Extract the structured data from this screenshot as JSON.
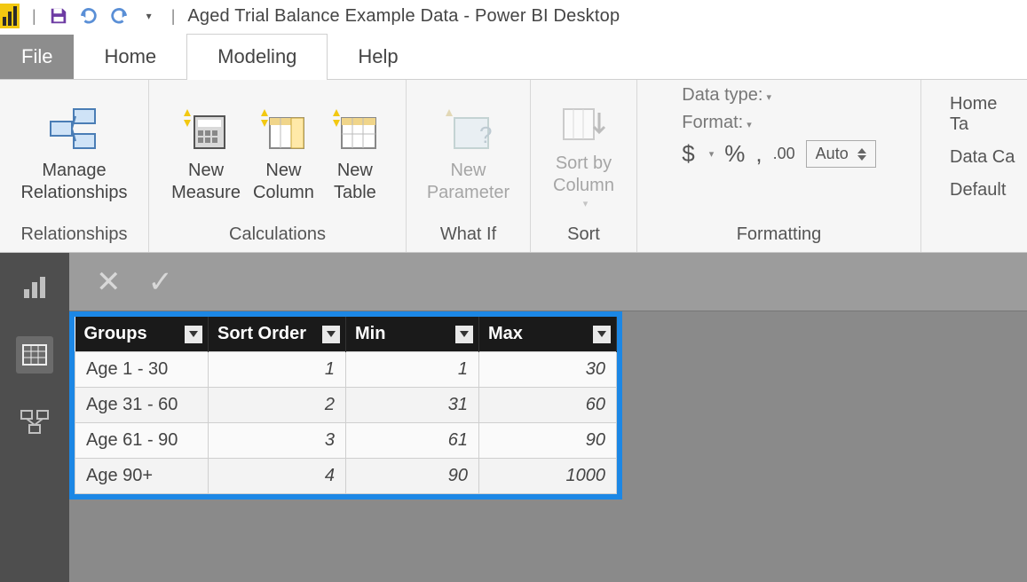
{
  "title": "Aged Trial Balance Example Data - Power BI Desktop",
  "menu": {
    "file": "File",
    "home": "Home",
    "modeling": "Modeling",
    "help": "Help"
  },
  "ribbon": {
    "relationships": {
      "manage": "Manage\nRelationships",
      "group": "Relationships"
    },
    "calculations": {
      "measure": "New\nMeasure",
      "column": "New\nColumn",
      "table": "New\nTable",
      "group": "Calculations"
    },
    "whatif": {
      "parameter": "New\nParameter",
      "group": "What If"
    },
    "sort": {
      "sortby": "Sort by\nColumn",
      "group": "Sort"
    },
    "formatting": {
      "datatype": "Data type:",
      "format": "Format:",
      "auto": "Auto",
      "group": "Formatting"
    },
    "properties": {
      "hometable": "Home Ta",
      "datacat": "Data Ca",
      "default": "Default"
    }
  },
  "table": {
    "columns": [
      "Groups",
      "Sort Order",
      "Min",
      "Max"
    ],
    "rows": [
      {
        "group": "Age 1 - 30",
        "sort": "1",
        "min": "1",
        "max": "30"
      },
      {
        "group": "Age 31 - 60",
        "sort": "2",
        "min": "31",
        "max": "60"
      },
      {
        "group": "Age 61 - 90",
        "sort": "3",
        "min": "61",
        "max": "90"
      },
      {
        "group": "Age 90+",
        "sort": "4",
        "min": "90",
        "max": "1000"
      }
    ]
  }
}
